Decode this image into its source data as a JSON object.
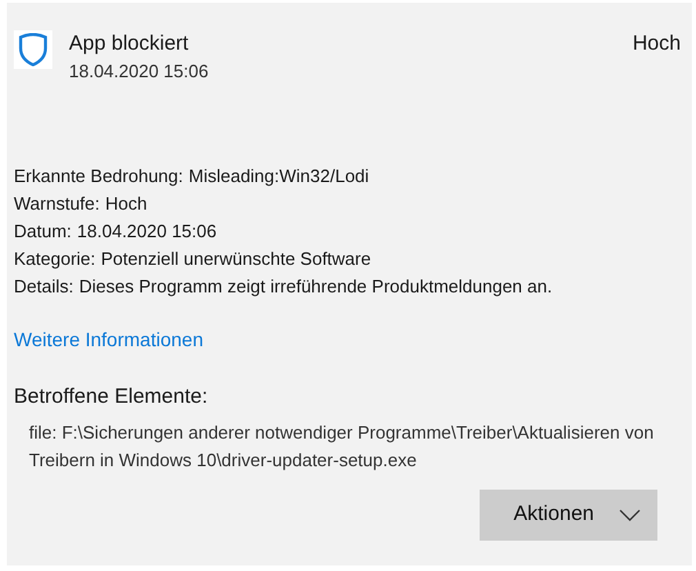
{
  "header": {
    "title": "App blockiert",
    "timestamp": "18.04.2020 15:06",
    "severity": "Hoch"
  },
  "details": [
    {
      "label": "Erkannte Bedrohung:",
      "value": "Misleading:Win32/Lodi"
    },
    {
      "label": "Warnstufe:",
      "value": "Hoch"
    },
    {
      "label": "Datum:",
      "value": "18.04.2020 15:06"
    },
    {
      "label": "Kategorie:",
      "value": "Potenziell unerwünschte Software"
    },
    {
      "label": "Details:",
      "value": "Dieses Programm zeigt irreführende Produktmeldungen an."
    }
  ],
  "link": "Weitere Informationen",
  "affected": {
    "heading": "Betroffene Elemente:",
    "items": [
      "file: F:\\Sicherungen anderer notwendiger Programme\\Treiber\\Aktualisieren von Treibern in Windows 10\\driver-updater-setup.exe"
    ]
  },
  "actions_button": "Aktionen"
}
